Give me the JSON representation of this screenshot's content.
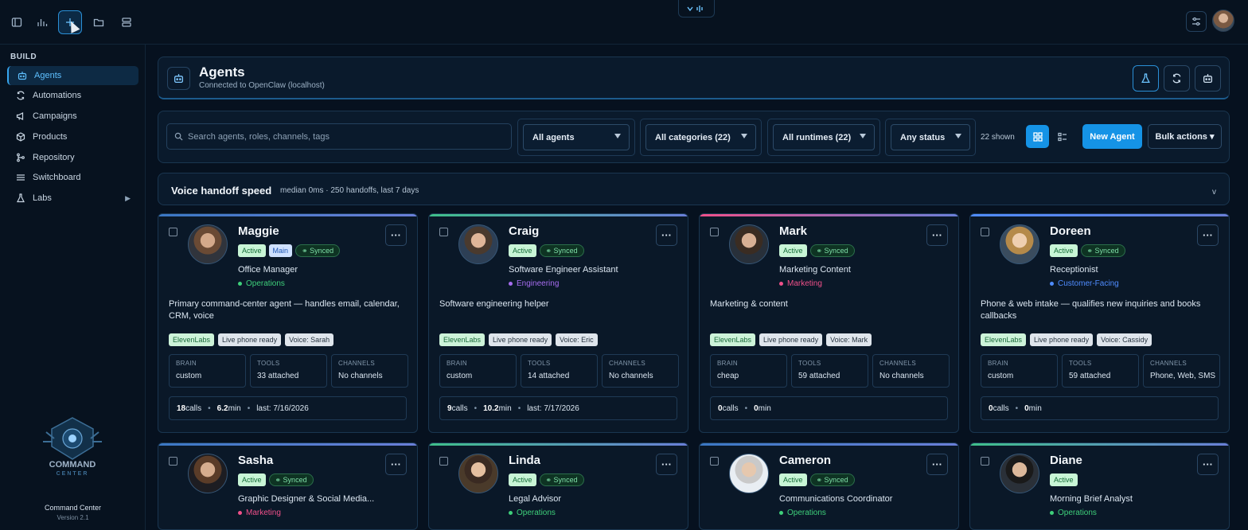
{
  "topbar": {
    "center_icon": "waveform-icon"
  },
  "sidebar": {
    "section": "BUILD",
    "items": [
      {
        "label": "Agents",
        "icon": "robot-icon",
        "active": true
      },
      {
        "label": "Automations",
        "icon": "refresh-icon"
      },
      {
        "label": "Campaigns",
        "icon": "megaphone-icon"
      },
      {
        "label": "Products",
        "icon": "box-icon"
      },
      {
        "label": "Repository",
        "icon": "git-branch-icon"
      },
      {
        "label": "Switchboard",
        "icon": "sliders-icon"
      },
      {
        "label": "Labs",
        "icon": "flask-icon",
        "has_submenu": true
      }
    ],
    "footer_name": "Command Center",
    "footer_version": "Version 2.1",
    "logo_text_1": "COMMAND",
    "logo_text_2": "CENTER"
  },
  "header": {
    "title": "Agents",
    "subtitle": "Connected to OpenClaw (localhost)"
  },
  "toolbar": {
    "search_placeholder": "Search agents, roles, channels, tags",
    "filter_agents": "All agents",
    "filter_categories": "All categories (22)",
    "filter_runtimes": "All runtimes (22)",
    "filter_status": "Any status",
    "shown": "22 shown",
    "new_agent": "New Agent",
    "bulk_actions": "Bulk actions ▾"
  },
  "voice": {
    "title": "Voice handoff speed",
    "subtitle": "median 0ms · 250 handoffs, last 7 days",
    "chevron": "v"
  },
  "labels": {
    "brain": "BRAIN",
    "tools": "TOOLS",
    "channels": "CHANNELS",
    "active": "Active",
    "main": "Main",
    "synced": "Synced",
    "more": "···"
  },
  "colors": {
    "accent": "#1593e6",
    "operations": "#3ecf7a",
    "engineering": "#a66cf0",
    "marketing": "#f0508a",
    "customer_facing": "#4f8cff"
  },
  "agents": [
    {
      "name": "Maggie",
      "role": "Office Manager",
      "dept": "Operations",
      "dept_color": "#3ecf7a",
      "main": true,
      "synced": true,
      "desc": "Primary command-center agent — handles email, calendar, CRM, voice",
      "tags": [
        "ElevenLabs",
        "Live phone ready",
        "Voice: Sarah"
      ],
      "brain": "custom",
      "tools": "33 attached",
      "channels": "No channels",
      "calls": "18 calls",
      "minutes": "6.2 min",
      "last": "last: 7/16/2026"
    },
    {
      "name": "Craig",
      "role": "Software Engineer Assistant",
      "dept": "Engineering",
      "dept_color": "#a66cf0",
      "main": false,
      "synced": true,
      "desc": "Software engineering helper",
      "tags": [
        "ElevenLabs",
        "Live phone ready",
        "Voice: Eric"
      ],
      "brain": "custom",
      "tools": "14 attached",
      "channels": "No channels",
      "calls": "9 calls",
      "minutes": "10.2 min",
      "last": "last: 7/17/2026"
    },
    {
      "name": "Mark",
      "role": "Marketing Content",
      "dept": "Marketing",
      "dept_color": "#f0508a",
      "main": false,
      "synced": true,
      "desc": "Marketing & content",
      "tags": [
        "ElevenLabs",
        "Live phone ready",
        "Voice: Mark"
      ],
      "brain": "cheap",
      "tools": "59 attached",
      "channels": "No channels",
      "calls": "0 calls",
      "minutes": "0 min",
      "last": ""
    },
    {
      "name": "Doreen",
      "role": "Receptionist",
      "dept": "Customer-Facing",
      "dept_color": "#4f8cff",
      "main": false,
      "synced": true,
      "desc": "Phone & web intake — qualifies new inquiries and books callbacks",
      "tags": [
        "ElevenLabs",
        "Live phone ready",
        "Voice: Cassidy"
      ],
      "brain": "custom",
      "tools": "59 attached",
      "channels": "Phone, Web, SMS",
      "calls": "0 calls",
      "minutes": "0 min",
      "last": ""
    },
    {
      "name": "Sasha",
      "role": "Graphic Designer & Social Media...",
      "dept": "Marketing",
      "dept_color": "#f0508a",
      "main": false,
      "synced": true
    },
    {
      "name": "Linda",
      "role": "Legal Advisor",
      "dept": "Operations",
      "dept_color": "#3ecf7a",
      "main": false,
      "synced": true
    },
    {
      "name": "Cameron",
      "role": "Communications Coordinator",
      "dept": "Operations",
      "dept_color": "#3ecf7a",
      "main": false,
      "synced": true
    },
    {
      "name": "Diane",
      "role": "Morning Brief Analyst",
      "dept": "Operations",
      "dept_color": "#3ecf7a",
      "main": false,
      "synced": false
    }
  ]
}
